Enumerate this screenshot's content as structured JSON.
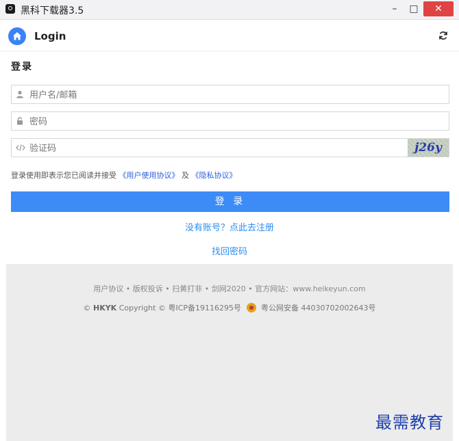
{
  "window": {
    "title": "黑科下载器3.5",
    "minimize": "–",
    "maximize": "□",
    "close": "✕"
  },
  "header": {
    "title": "Login"
  },
  "form": {
    "section_title": "登录",
    "username_placeholder": "用户名/邮箱",
    "password_placeholder": "密码",
    "captcha_placeholder": "验证码",
    "captcha_text": "j26y",
    "agree_prefix": "登录使用即表示您已阅读并接受",
    "agree_user": "《用户使用协议》",
    "agree_and": "及",
    "agree_privacy": "《隐私协议》",
    "login_button": "登 录",
    "register_link": "没有账号？点此去注册",
    "forgot_link": "找回密码"
  },
  "footer": {
    "links": "用户协议 • 版权投诉 • 扫黄打非 • 剑网2020 • 官方网站：www.heikeyun.com",
    "copy_prefix": "©",
    "brand": "HKYK",
    "copy_text": "Copyright © 粤ICP备19116295号",
    "police": "粤公网安备 44030702002643号"
  },
  "watermark": "最需教育",
  "colors": {
    "accent": "#3d8bf7",
    "link": "#2d8cf0",
    "close": "#e04343"
  }
}
